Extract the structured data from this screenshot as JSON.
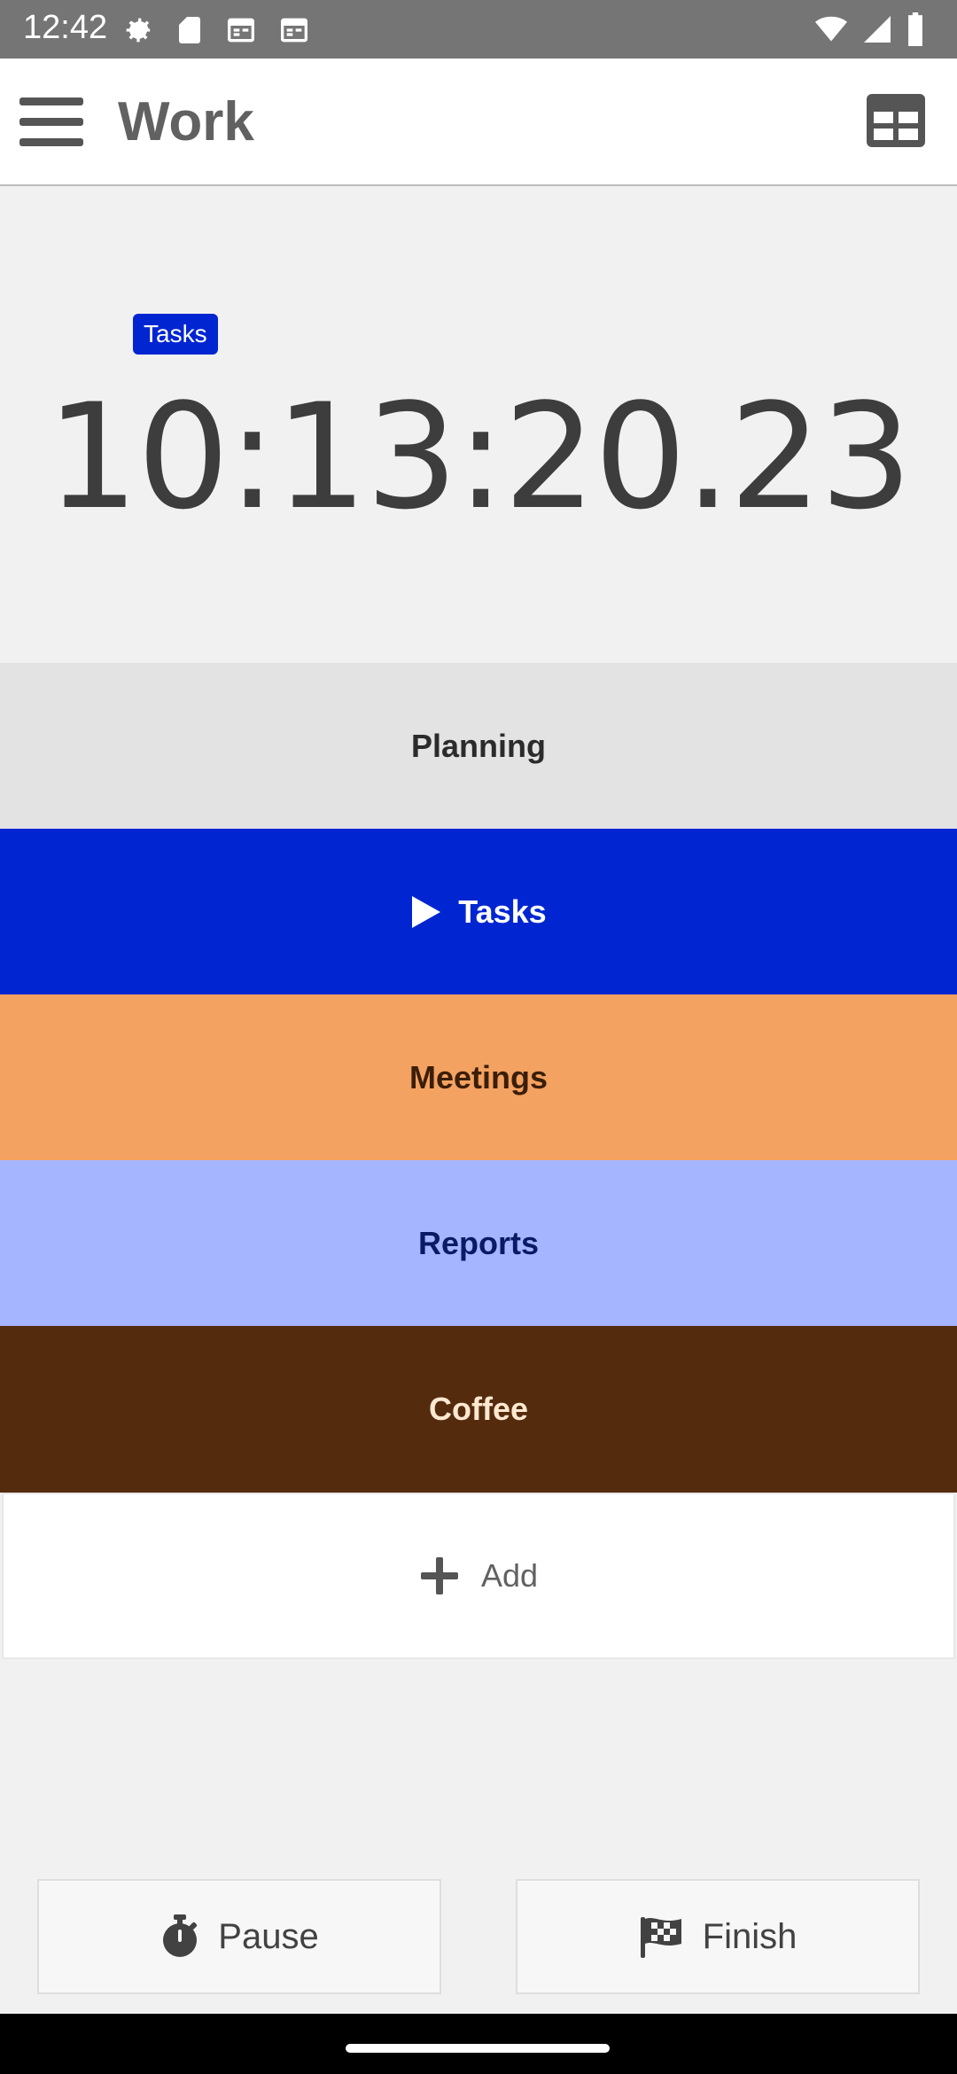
{
  "status_bar": {
    "time": "12:42"
  },
  "app_bar": {
    "title": "Work"
  },
  "timer": {
    "current_activity": "Tasks",
    "elapsed": "10:13:20.23"
  },
  "activities": [
    {
      "label": "Planning",
      "bg": "#e3e3e3",
      "fg": "#2b2b2b",
      "active": false
    },
    {
      "label": "Tasks",
      "bg": "#0126d1",
      "fg": "#ffffff",
      "active": true
    },
    {
      "label": "Meetings",
      "bg": "#f4a261",
      "fg": "#3b1e08",
      "active": false
    },
    {
      "label": "Reports",
      "bg": "#a5b5ff",
      "fg": "#0a1a66",
      "active": false
    },
    {
      "label": "Coffee",
      "bg": "#552b0e",
      "fg": "#ffe8d0",
      "active": false
    }
  ],
  "add": {
    "label": "Add"
  },
  "bottom_actions": {
    "pause_label": "Pause",
    "finish_label": "Finish"
  }
}
